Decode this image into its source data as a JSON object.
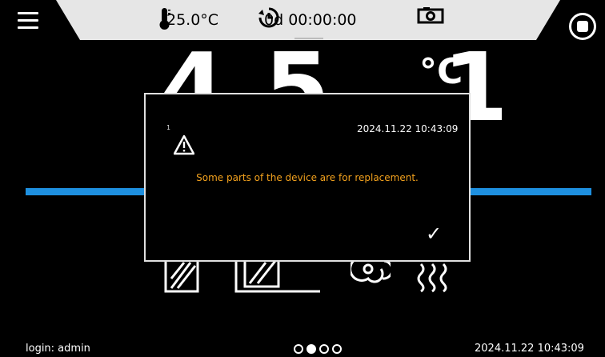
{
  "status_bar": {
    "ambient_temperature": "25.0°C",
    "timer": "0d 00:00:00",
    "icons": [
      "menu-icon",
      "thermometer-icon",
      "timer-icon",
      "camera-icon",
      "stop-icon"
    ]
  },
  "main": {
    "temperature_value": "45.1",
    "temperature_unit": "°C",
    "accent_color": "#1e90e0"
  },
  "dialog": {
    "index": "1",
    "datetime": "2024.11.22 10:43:09",
    "message": "Some parts of the device are for replacement.",
    "confirm_symbol": "✓",
    "message_color": "#f2a11d",
    "icon": "warning-icon"
  },
  "footer": {
    "login": "login: admin",
    "datetime": "2024.11.22  10:43:09",
    "page_count": 4,
    "active_page": 2
  }
}
